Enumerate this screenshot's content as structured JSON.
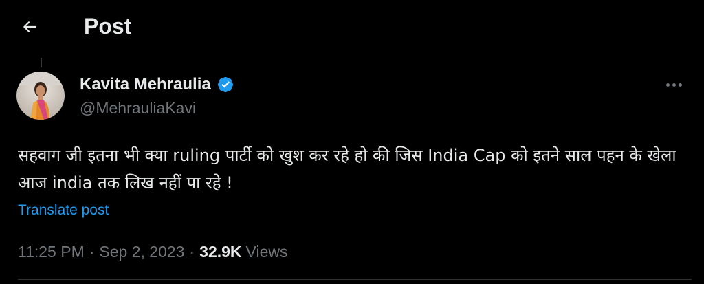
{
  "header": {
    "title": "Post",
    "back_icon": "arrow-left-icon"
  },
  "author": {
    "name": "Kavita Mehraulia",
    "handle": "@MehrauliaKavi",
    "verified": true,
    "verified_color": "#1d9bf0"
  },
  "post": {
    "text": "सहवाग जी इतना भी क्या ruling पार्टी को खुश कर रहे हो की जिस India Cap को इतने साल पहन के खेला आज india तक लिख नहीं पा रहे !",
    "translate_label": "Translate post",
    "time": "11:25 PM",
    "date": "Sep 2, 2023",
    "views_count": "32.9K",
    "views_label": "Views",
    "separator": "·"
  },
  "colors": {
    "background": "#000000",
    "text_primary": "#e7e9ea",
    "text_secondary": "#71767b",
    "link": "#1d9bf0"
  }
}
